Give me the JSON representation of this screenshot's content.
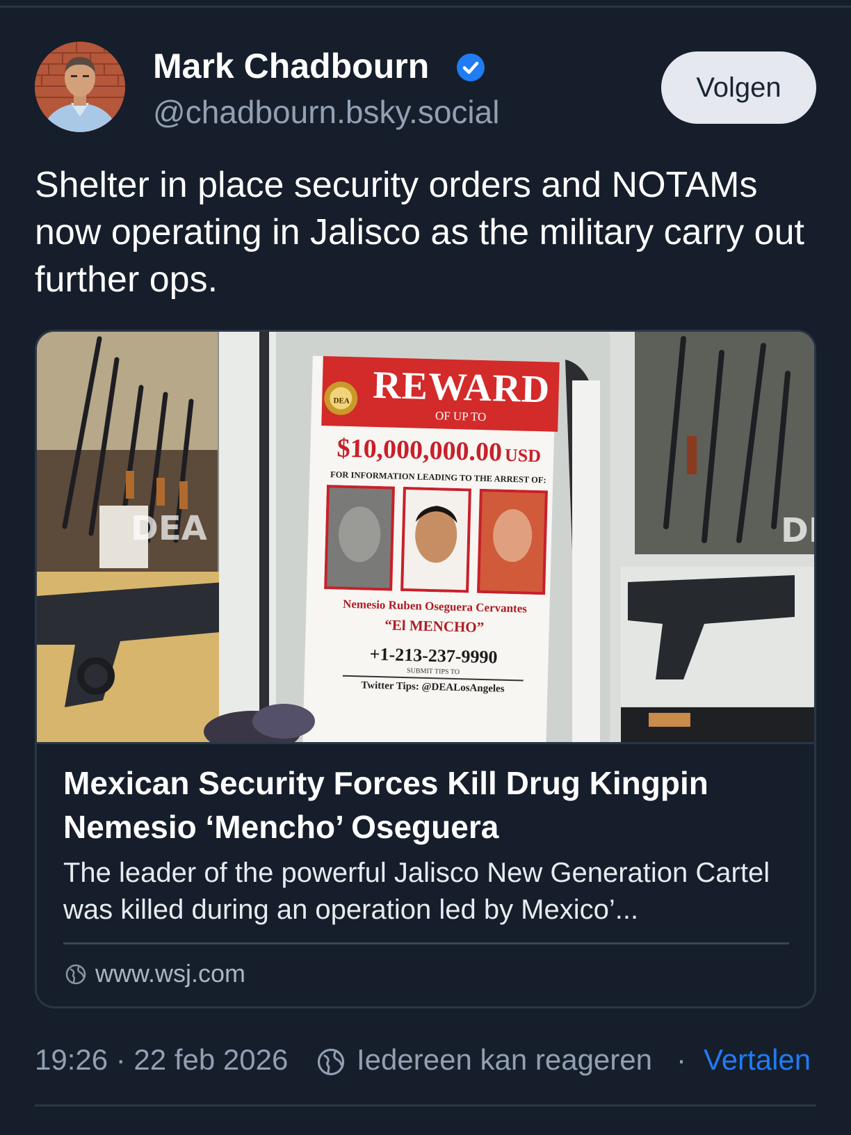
{
  "post": {
    "author": {
      "display_name": "Mark Chadbourn",
      "handle": "@chadbourn.bsky.social",
      "verified": true
    },
    "follow_label": "Volgen",
    "text": "Shelter in place security orders and NOTAMs now operating in Jalisco as the military carry out further ops.",
    "link_card": {
      "image": {
        "reward_title": "REWARD",
        "reward_sub": "OF UP TO",
        "amount": "$10,000,000.00",
        "currency": "USD",
        "info_line": "FOR INFORMATION LEADING TO THE ARREST OF:",
        "name_line1": "Nemesio Ruben Oseguera Cervantes",
        "name_line2": "“El MENCHO”",
        "phone": "+1-213-237-9990",
        "submit_tips": "SUBMIT TIPS TO",
        "twitter_tips": "Twitter Tips: @DEALosAngeles",
        "dea_badge": "DEA",
        "dea_watermark_left": "DEA",
        "dea_watermark_right": "DE"
      },
      "title": "Mexican Security Forces Kill Drug Kingpin Nemesio ‘Mencho’ Oseguera",
      "description": "The leader of the powerful Jalisco New Generation Cartel was killed during an operation led by Mexico’...",
      "domain": "www.wsj.com"
    },
    "meta": {
      "timestamp": "19:26 · 22 feb 2026",
      "reply_setting": "Iedereen kan reageren",
      "separator": "·",
      "translate_label": "Vertalen"
    }
  },
  "icons": {
    "verified": "verified-check-icon",
    "globe": "globe-icon"
  },
  "colors": {
    "background": "#161e2b",
    "accent": "#1f7cf2",
    "muted_text": "#93a0b3",
    "reward_red": "#d32a2a"
  }
}
